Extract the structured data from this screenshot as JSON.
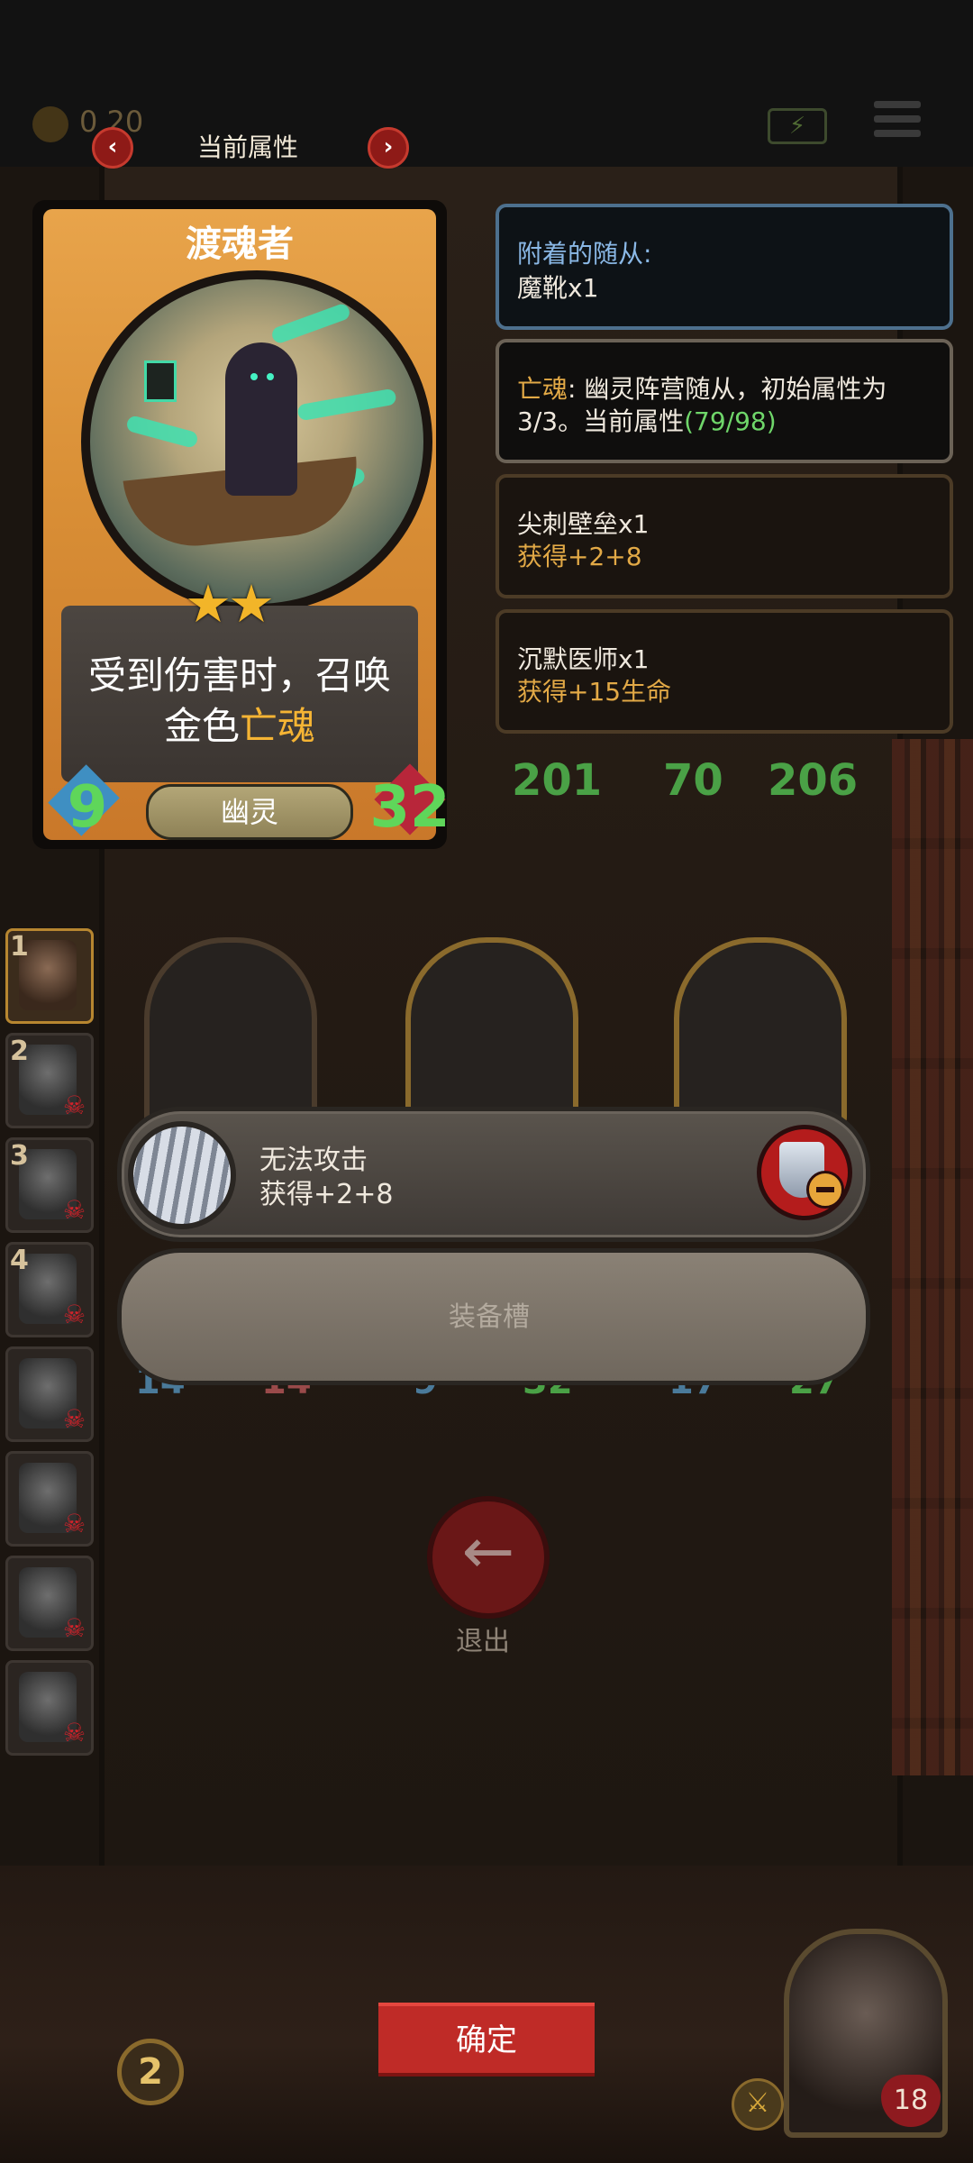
{
  "topbar": {
    "gold_value": "0 20",
    "energy_icon": "battery-bolt-icon",
    "menu_icon": "hamburger-menu-icon",
    "title": "当前属性"
  },
  "card": {
    "name": "渡魂者",
    "stars": "★★",
    "desc_line1": "受到伤害时，召唤",
    "desc_line2_prefix": "金色",
    "desc_line2_keyword": "亡魂",
    "type": "幽灵",
    "attack": "9",
    "health": "32"
  },
  "panels": {
    "attached_title": "附着的随从:",
    "attached_item": "魔靴x1",
    "keyword_name": "亡魂",
    "keyword_line1_rest": ": 幽灵阵营随从，初始属性为",
    "keyword_line2_prefix": "3/3。当前属性",
    "keyword_line2_value": "(79/98)",
    "item1_name": "尖刺壁垒x1",
    "item1_effect": "获得+2+8",
    "item2_name": "沉默医师x1",
    "item2_effect": "获得+15生命"
  },
  "minion_list": [
    "1",
    "2",
    "3",
    "4",
    "",
    "",
    "",
    ""
  ],
  "board": {
    "stat_a": "201",
    "stat_b": "70",
    "stat_c": "206",
    "row2": [
      "14",
      "14",
      "9",
      "32",
      "17",
      "27"
    ]
  },
  "equipment": {
    "name": "无法攻击",
    "effect": "获得+2+8",
    "slot_label": "装备槽"
  },
  "exit_label": "退出",
  "confirm_label": "确定",
  "player": {
    "level": "2",
    "health": "18"
  },
  "colors": {
    "accent_red": "#bf2b27",
    "stat_green": "#5fd65a",
    "keyword_gold": "#f5b434"
  }
}
